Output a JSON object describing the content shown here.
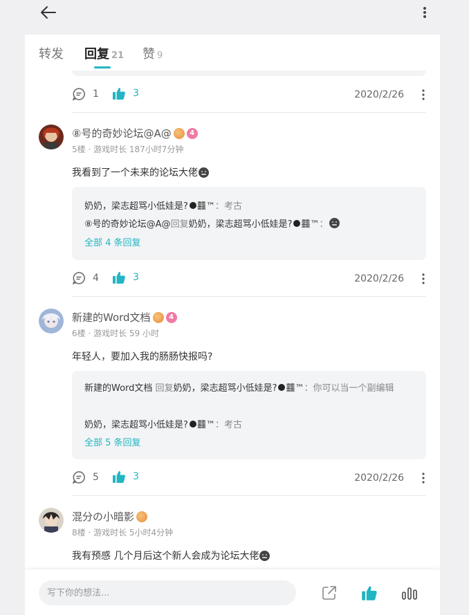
{
  "tabs": [
    {
      "label": "转发",
      "count": ""
    },
    {
      "label": "回复",
      "count": "21"
    },
    {
      "label": "赞",
      "count": "9"
    }
  ],
  "prev_actions": {
    "comments": "1",
    "likes": "3",
    "date": "2020/2/26"
  },
  "posts": [
    {
      "username": "⑧号的奇妙论坛@A@",
      "level": "4",
      "meta": "5楼 · 游戏时长 187小时7分钟",
      "text": "我看到了一个未来的论坛大佬",
      "replies": [
        {
          "name": "奶奶，梁志超骂小低娃是?",
          "suffix": "䨻™",
          "sep": "：",
          "content": "考古"
        },
        {
          "name": "⑧号的奇妙论坛@A@",
          "mid": " 回复",
          "target": "奶奶，梁志超骂小低娃是?",
          "suffix": "䨻™",
          "sep": "："
        }
      ],
      "more": "全部 4 条回复",
      "comments": "4",
      "likes": "3",
      "date": "2020/2/26"
    },
    {
      "username": "新建的Word文档",
      "level": "4",
      "meta": "6楼 · 游戏时长 59 小时",
      "text": "年轻人，要加入我的肠肠快报吗?",
      "replies": [
        {
          "name": "新建的Word文档",
          "mid": " 回复",
          "target": "奶奶，梁志超骂小低娃是?",
          "suffix": "䨻™",
          "sep": "：",
          "content": "你可以当一个副编辑"
        },
        {
          "name": "奶奶，梁志超骂小低娃是?",
          "suffix": "䨻™",
          "sep": "：",
          "content": "考古"
        }
      ],
      "more": "全部 5 条回复",
      "comments": "5",
      "likes": "3",
      "date": "2020/2/26"
    },
    {
      "username": "混分の小暗影",
      "meta": "8楼 · 游戏时长 5小时4分钟",
      "text": "我有预感 几个月后这个新人会成为论坛大佬"
    }
  ],
  "bottom": {
    "placeholder": "写下你的想法..."
  },
  "colors": {
    "accent": "#22b5c2",
    "badge": "#f07aa5"
  }
}
